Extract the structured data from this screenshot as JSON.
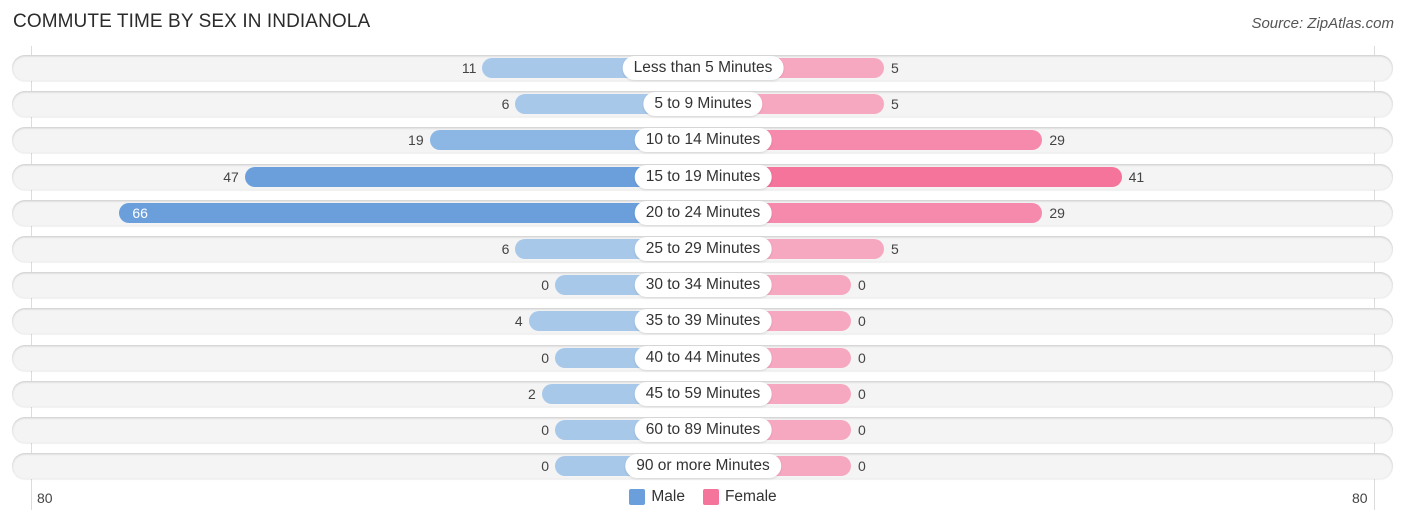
{
  "header": {
    "title": "COMMUTE TIME BY SEX IN INDIANOLA",
    "source": "Source: ZipAtlas.com"
  },
  "colors": {
    "male": "#6a9fdc",
    "male_light": "#a8c8ea",
    "female": "#f4749b",
    "female_light": "#f7a8c1",
    "row_background": "#f4f4f4"
  },
  "chart_data": {
    "type": "bar",
    "orientation": "horizontal-diverging",
    "title": "COMMUTE TIME BY SEX IN INDIANOLA",
    "categories": [
      "Less than 5 Minutes",
      "5 to 9 Minutes",
      "10 to 14 Minutes",
      "15 to 19 Minutes",
      "20 to 24 Minutes",
      "25 to 29 Minutes",
      "30 to 34 Minutes",
      "35 to 39 Minutes",
      "40 to 44 Minutes",
      "45 to 59 Minutes",
      "60 to 89 Minutes",
      "90 or more Minutes"
    ],
    "series": [
      {
        "name": "Male",
        "values": [
          11,
          6,
          19,
          47,
          66,
          6,
          0,
          4,
          0,
          2,
          0,
          0
        ]
      },
      {
        "name": "Female",
        "values": [
          5,
          5,
          29,
          41,
          29,
          5,
          0,
          0,
          0,
          0,
          0,
          0
        ]
      }
    ],
    "axis": {
      "left_label": "80",
      "right_label": "80",
      "range": [
        -80,
        80
      ]
    },
    "legend": {
      "position": "bottom-center",
      "entries": [
        "Male",
        "Female"
      ]
    },
    "grid": false
  }
}
